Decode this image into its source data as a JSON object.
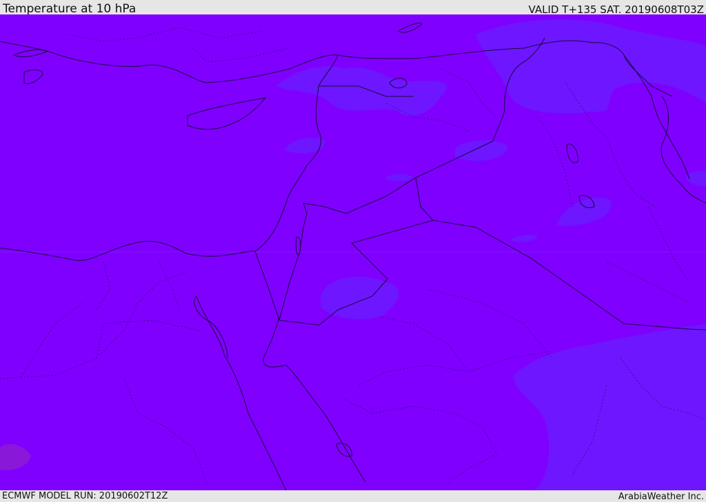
{
  "header": {
    "title": "Temperature at 10 hPa",
    "valid": "VALID T+135 SAT. 20190608T03Z"
  },
  "footer": {
    "model_run": "ECMWF MODEL RUN: 20190602T12Z",
    "credit": "ArabiaWeather Inc."
  },
  "map": {
    "background_color": "#7f00ff",
    "warm_patch_color": "#6a1aff",
    "cold_patch_color": "#8a18d8",
    "border_color": "#1a0b3a"
  }
}
